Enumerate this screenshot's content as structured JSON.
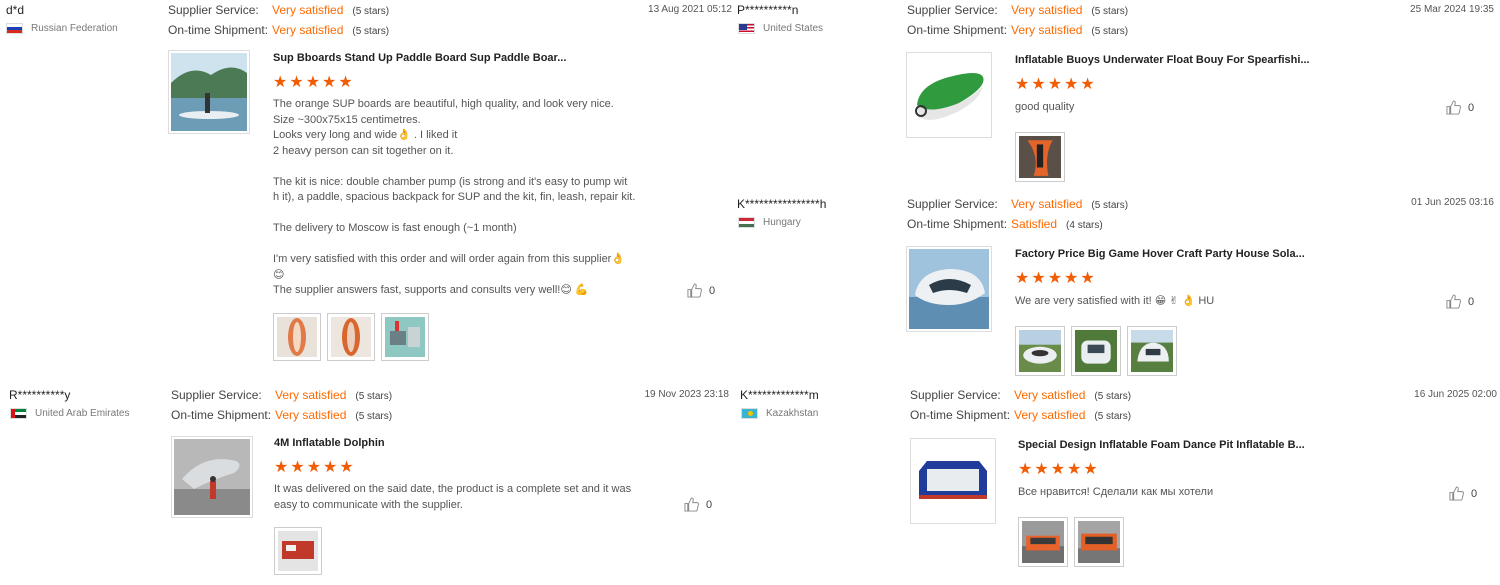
{
  "labels": {
    "supplier_service": "Supplier Service:",
    "ontime_shipment": "On-time Shipment:"
  },
  "reviews": [
    {
      "buyer": "d*d",
      "country": "Russian Federation",
      "supplier_service": "Very satisfied",
      "supplier_stars": "(5 stars)",
      "ontime": "Very satisfied",
      "ontime_stars": "(5 stars)",
      "date": "13 Aug 2021 05:12",
      "product_title": "Sup Bboards Stand Up Paddle Board Sup Paddle Boar...",
      "rating": 5,
      "text": "The orange SUP boards are beautiful, high quality, and look very nice.\nSize ~300x75x15 centimetres.\nLooks very long and wide👌 . I liked it\n2 heavy person can sit together on it.\n\nThe kit is nice: double chamber pump (is strong and it's easy to pump wit\nh it), a paddle, spacious backpack for SUP and the kit, fin, leash, repair kit.\n\nThe delivery to Moscow is fast enough (~1 month)\n\nI'm very satisfied with this order and will order again from this supplier👌\n😊\nThe supplier answers fast, supports and consults very well!😊 💪",
      "likes": "0"
    },
    {
      "buyer": "P**********n",
      "country": "United States",
      "supplier_service": "Very satisfied",
      "supplier_stars": "(5 stars)",
      "ontime": "Very satisfied",
      "ontime_stars": "(5 stars)",
      "date": "25 Mar 2024 19:35",
      "product_title": "Inflatable Buoys Underwater Float Bouy For Spearfishi...",
      "rating": 5,
      "text": "good quality",
      "likes": "0"
    },
    {
      "buyer": "K****************h",
      "country": "Hungary",
      "supplier_service": "Very satisfied",
      "supplier_stars": "(5 stars)",
      "ontime": "Satisfied",
      "ontime_stars": "(4 stars)",
      "date": "01 Jun 2025 03:16",
      "product_title": "Factory Price Big Game Hover Craft Party House Sola...",
      "rating": 5,
      "text": "We are very satisfied with it! 😁 ✌ 👌 HU",
      "likes": "0"
    },
    {
      "buyer": "R**********y",
      "country": "United Arab Emirates",
      "supplier_service": "Very satisfied",
      "supplier_stars": "(5 stars)",
      "ontime": "Very satisfied",
      "ontime_stars": "(5 stars)",
      "date": "19 Nov 2023 23:18",
      "product_title": "4M Inflatable Dolphin",
      "rating": 5,
      "text": "It was delivered on the said date, the product is a complete set and it was\neasy to communicate with the supplier.",
      "likes": "0"
    },
    {
      "buyer": "K*************m",
      "country": "Kazakhstan",
      "supplier_service": "Very satisfied",
      "supplier_stars": "(5 stars)",
      "ontime": "Very satisfied",
      "ontime_stars": "(5 stars)",
      "date": "16 Jun 2025 02:00",
      "product_title": "Special Design Inflatable Foam Dance Pit Inflatable B...",
      "rating": 5,
      "text": "Все нравится! Сделали как мы хотели",
      "likes": "0"
    }
  ],
  "colors": {
    "accent": "#ff6a00",
    "star": "#f25c05"
  }
}
